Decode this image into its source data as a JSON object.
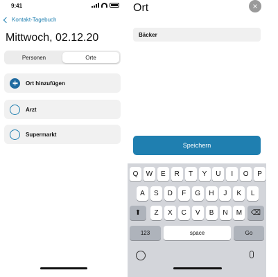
{
  "status": {
    "time": "9:41"
  },
  "nav": {
    "back_label": "Kontakt-Tagebuch"
  },
  "page": {
    "date_title": "Mittwoch, 02.12.20"
  },
  "segments": [
    {
      "label": "Personen",
      "active": false
    },
    {
      "label": "Orte",
      "active": true
    }
  ],
  "list": {
    "add_label": "Ort hinzufügen",
    "items": [
      "Arzt",
      "Supermarkt"
    ]
  },
  "modal": {
    "title": "Ort",
    "input_value": "Bäcker",
    "save_label": "Speichern",
    "close_glyph": "×"
  },
  "keyboard": {
    "row1": [
      "Q",
      "W",
      "E",
      "R",
      "T",
      "Y",
      "U",
      "I",
      "O",
      "P"
    ],
    "row2": [
      "A",
      "S",
      "D",
      "F",
      "G",
      "H",
      "J",
      "K",
      "L"
    ],
    "row3": [
      "Z",
      "X",
      "C",
      "V",
      "B",
      "N",
      "M"
    ],
    "num_label": "123",
    "space_label": "space",
    "go_label": "Go",
    "shift_glyph": "⬆",
    "delete_glyph": "⌫"
  },
  "colors": {
    "accent": "#1f7fb0",
    "keyboard_bg": "#d3d5da"
  }
}
